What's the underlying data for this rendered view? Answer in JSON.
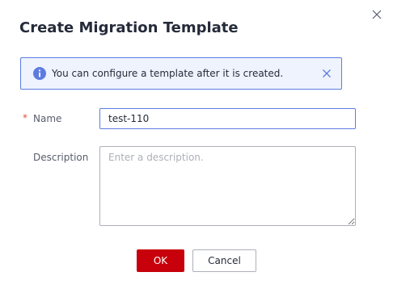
{
  "dialog": {
    "title": "Create Migration Template",
    "alert": {
      "text": "You can configure a template after it is created.",
      "icon": "info-icon"
    },
    "form": {
      "name": {
        "required_mark": "*",
        "label": "Name",
        "value": "test-110"
      },
      "description": {
        "label": "Description",
        "placeholder": "Enter a description.",
        "value": ""
      }
    },
    "buttons": {
      "ok_label": "OK",
      "cancel_label": "Cancel"
    }
  },
  "colors": {
    "primary_button": "#c7000b",
    "alert_border": "#5e7ce0",
    "alert_background": "#eef3fd",
    "info_icon": "#5e7ce0",
    "required_mark": "#e15045"
  }
}
